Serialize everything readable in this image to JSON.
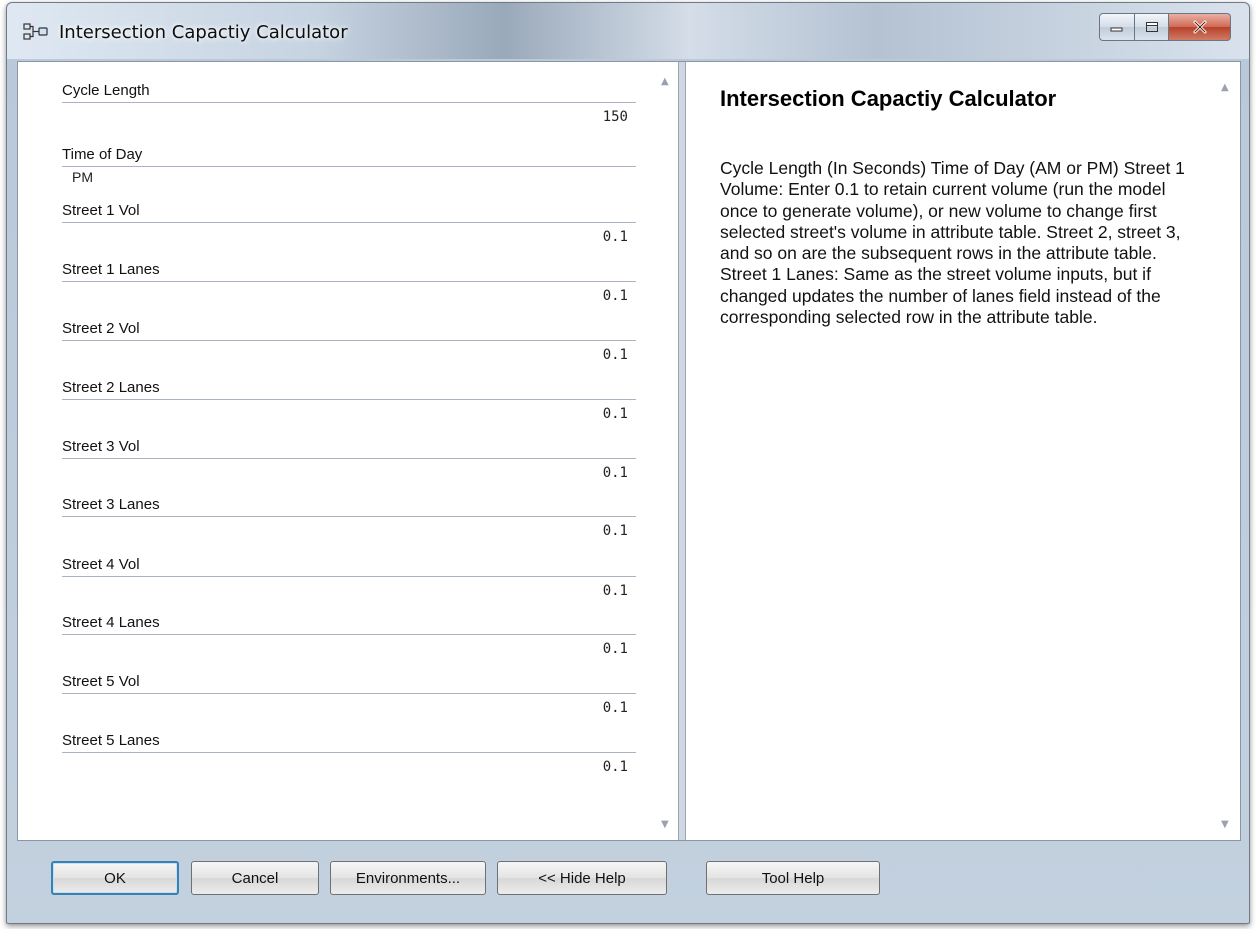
{
  "window": {
    "title": "Intersection Capactiy Calculator"
  },
  "form": {
    "fields": [
      {
        "label": "Cycle Length",
        "value": "150"
      },
      {
        "label": "Time of Day",
        "value": "PM"
      },
      {
        "label": "Street 1 Vol",
        "value": "0.1"
      },
      {
        "label": "Street 1 Lanes",
        "value": "0.1"
      },
      {
        "label": "Street 2 Vol",
        "value": "0.1"
      },
      {
        "label": "Street 2 Lanes",
        "value": "0.1"
      },
      {
        "label": "Street 3 Vol",
        "value": "0.1"
      },
      {
        "label": "Street 3 Lanes",
        "value": "0.1"
      },
      {
        "label": "Street 4 Vol",
        "value": "0.1"
      },
      {
        "label": "Street 4 Lanes",
        "value": "0.1"
      },
      {
        "label": "Street 5 Vol",
        "value": "0.1"
      },
      {
        "label": "Street 5 Lanes",
        "value": "0.1"
      }
    ]
  },
  "help": {
    "title": "Intersection Capactiy Calculator",
    "body": "Cycle Length (In Seconds) Time of Day (AM or PM) Street 1 Volume: Enter 0.1 to retain current volume (run the model once to generate volume), or new volume to change first selected street's volume in attribute table. Street 2, street 3, and so on are the subsequent rows in the attribute table. Street 1 Lanes: Same as the street volume inputs, but if changed updates the number of lanes field instead of the corresponding selected row in the attribute table."
  },
  "buttons": {
    "ok": "OK",
    "cancel": "Cancel",
    "environments": "Environments...",
    "hide_help": "<< Hide Help",
    "tool_help": "Tool Help"
  },
  "icons": {
    "app": "model-builder-icon",
    "minimize": "minimize-icon",
    "maximize": "maximize-icon",
    "close": "close-icon"
  }
}
